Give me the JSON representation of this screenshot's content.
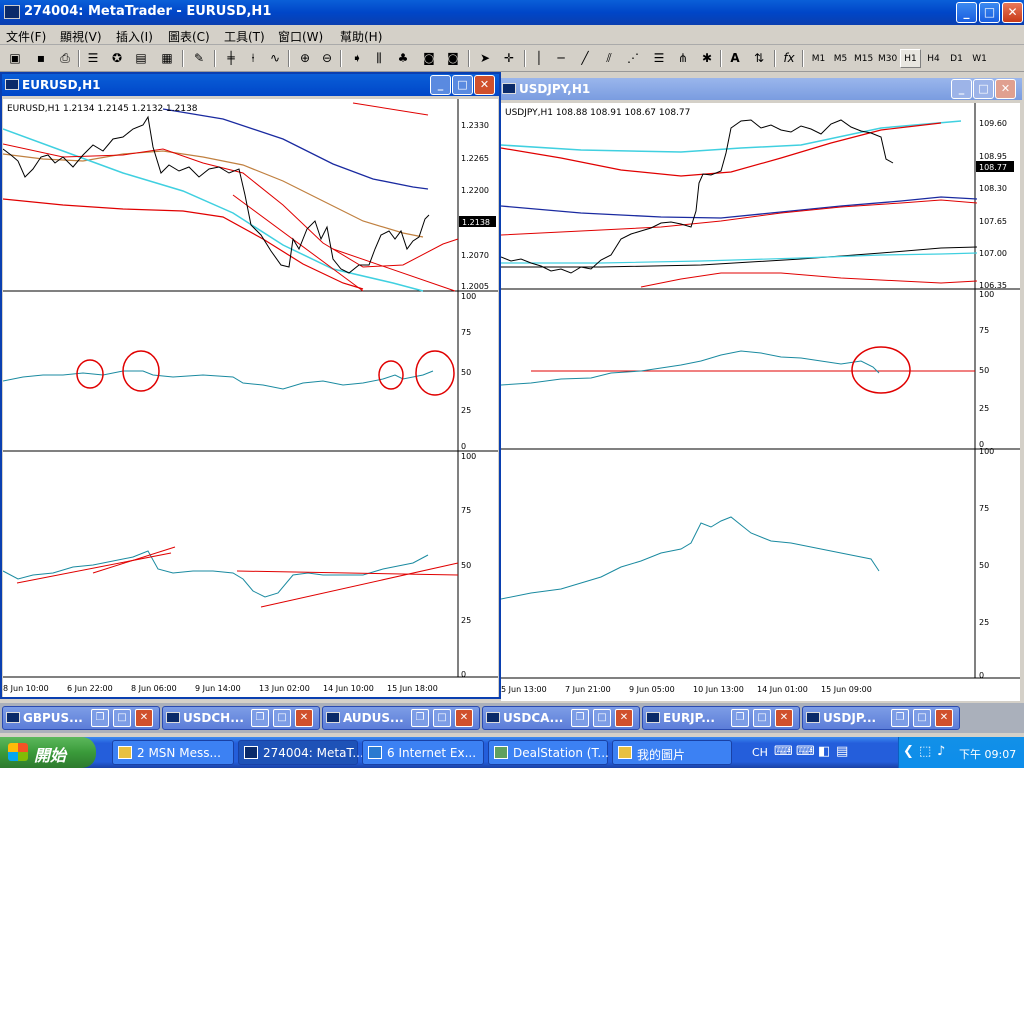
{
  "window": {
    "title": "274004: MetaTrader - EURUSD,H1"
  },
  "menu": [
    "文件(F)",
    "顯視(V)",
    "插入(I)",
    "圖表(C)",
    "工具(T)",
    "窗口(W)",
    "幫助(H)"
  ],
  "toolbar": {
    "timeframes": [
      "M1",
      "M5",
      "M15",
      "M30",
      "H1",
      "H4",
      "D1",
      "W1"
    ],
    "selected_timeframe": "H1"
  },
  "icons": [
    "new-chart-icon",
    "open-icon",
    "print-icon",
    "market-watch-icon",
    "data-window-icon",
    "navigator-icon",
    "terminal-icon",
    "tester-icon",
    "autotrading-icon",
    "bar-chart-icon",
    "candles-icon",
    "line-chart-icon",
    "zoom-in-icon",
    "zoom-out-icon",
    "autoscroll-icon",
    "chart-shift-icon",
    "indicators-icon",
    "periods-icon",
    "templates-icon",
    "cursor-icon",
    "crosshair-icon",
    "vertical-line-icon",
    "horizontal-line-icon",
    "trendline-icon",
    "channel-icon",
    "gann-icon",
    "fibonacci-icon",
    "andrews-icon",
    "text-icon",
    "arrow-icon",
    "function-icon"
  ],
  "eurusd": {
    "title": "EURUSD,H1",
    "info": "EURUSD,H1  1.2134 1.2145 1.2132 1.2138",
    "price_ticks": [
      "1.2330",
      "1.2265",
      "1.2200",
      "1.2070",
      "1.2005"
    ],
    "current_price": "1.2138",
    "osc_ticks": [
      "100",
      "75",
      "50",
      "25",
      "0"
    ],
    "time_labels": [
      "8 Jun 10:00",
      "6 Jun 22:00",
      "8 Jun 06:00",
      "9 Jun 14:00",
      "13 Jun 02:00",
      "14 Jun 10:00",
      "15 Jun 18:00"
    ]
  },
  "usdjpy": {
    "title": "USDJPY,H1",
    "info": "USDJPY,H1  108.88 108.91 108.67 108.77",
    "price_ticks": [
      "109.60",
      "108.95",
      "108.30",
      "107.65",
      "107.00",
      "106.35"
    ],
    "current_price": "108.77",
    "osc_ticks": [
      "100",
      "75",
      "50",
      "25",
      "0"
    ],
    "time_labels": [
      "5 Jun 13:00",
      "7 Jun 21:00",
      "9 Jun 05:00",
      "10 Jun 13:00",
      "14 Jun 01:00",
      "15 Jun 09:00"
    ]
  },
  "minimized": [
    "GBPUS...",
    "USDCH...",
    "AUDUS...",
    "USDCA...",
    "EURJP...",
    "USDJP..."
  ],
  "taskbar": {
    "start": "開始",
    "tasks": [
      "2 MSN Mess...",
      "274004: MetaT...",
      "6 Internet Ex...",
      "DealStation (T...",
      "我的圖片"
    ],
    "lang": "CH",
    "clock": "下午 09:07"
  },
  "colors": {
    "xp_blue": "#0a5fd8",
    "red": "#e00000",
    "teal": "#1a8aa0",
    "navy": "#1a2aa0",
    "tan": "#c08040",
    "cyan": "#40d0e0"
  }
}
